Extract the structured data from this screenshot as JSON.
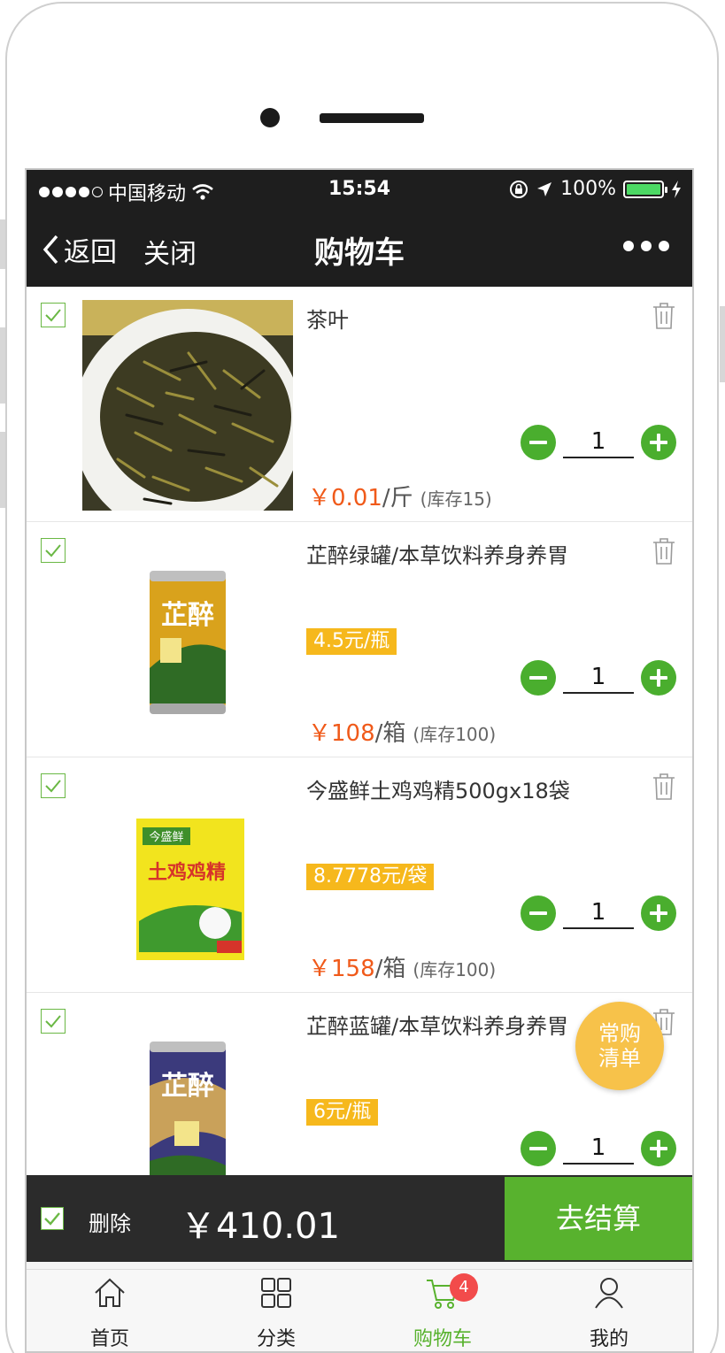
{
  "status": {
    "carrier": "中国移动",
    "time": "15:54",
    "battery": "100%"
  },
  "nav": {
    "back": "返回",
    "close": "关闭",
    "title": "购物车"
  },
  "items": [
    {
      "name": "茶叶",
      "tag": "",
      "price": "￥0.01",
      "unit": "/斤",
      "stock": "(库存15)",
      "qty": "1",
      "image": "tea-leaves-image"
    },
    {
      "name": "芷醉绿罐/本草饮料养身养胃",
      "tag": "4.5元/瓶",
      "price": "￥108",
      "unit": "/箱",
      "stock": "(库存100)",
      "qty": "1",
      "image": "zhizui-green-can-image"
    },
    {
      "name": "今盛鲜土鸡鸡精500gx18袋",
      "tag": "8.7778元/袋",
      "price": "￥158",
      "unit": "/箱",
      "stock": "(库存100)",
      "qty": "1",
      "image": "chicken-essence-bag-image"
    },
    {
      "name": "芷醉蓝罐/本草饮料养身养胃",
      "tag": "6元/瓶",
      "price": "",
      "unit": "",
      "stock": "",
      "qty": "1",
      "image": "zhizui-blue-can-image"
    }
  ],
  "float_button": {
    "line1": "常购",
    "line2": "清单"
  },
  "checkout": {
    "delete": "删除",
    "total": "￥410.01",
    "pay": "去结算"
  },
  "tabs": [
    {
      "label": "首页",
      "icon": "home-icon"
    },
    {
      "label": "分类",
      "icon": "grid-icon"
    },
    {
      "label": "购物车",
      "icon": "cart-icon",
      "badge": "4"
    },
    {
      "label": "我的",
      "icon": "user-icon"
    }
  ],
  "colors": {
    "accent": "#58b22e",
    "price": "#f05a1a",
    "tag": "#f6b81c",
    "dark": "#1e1e1e"
  }
}
